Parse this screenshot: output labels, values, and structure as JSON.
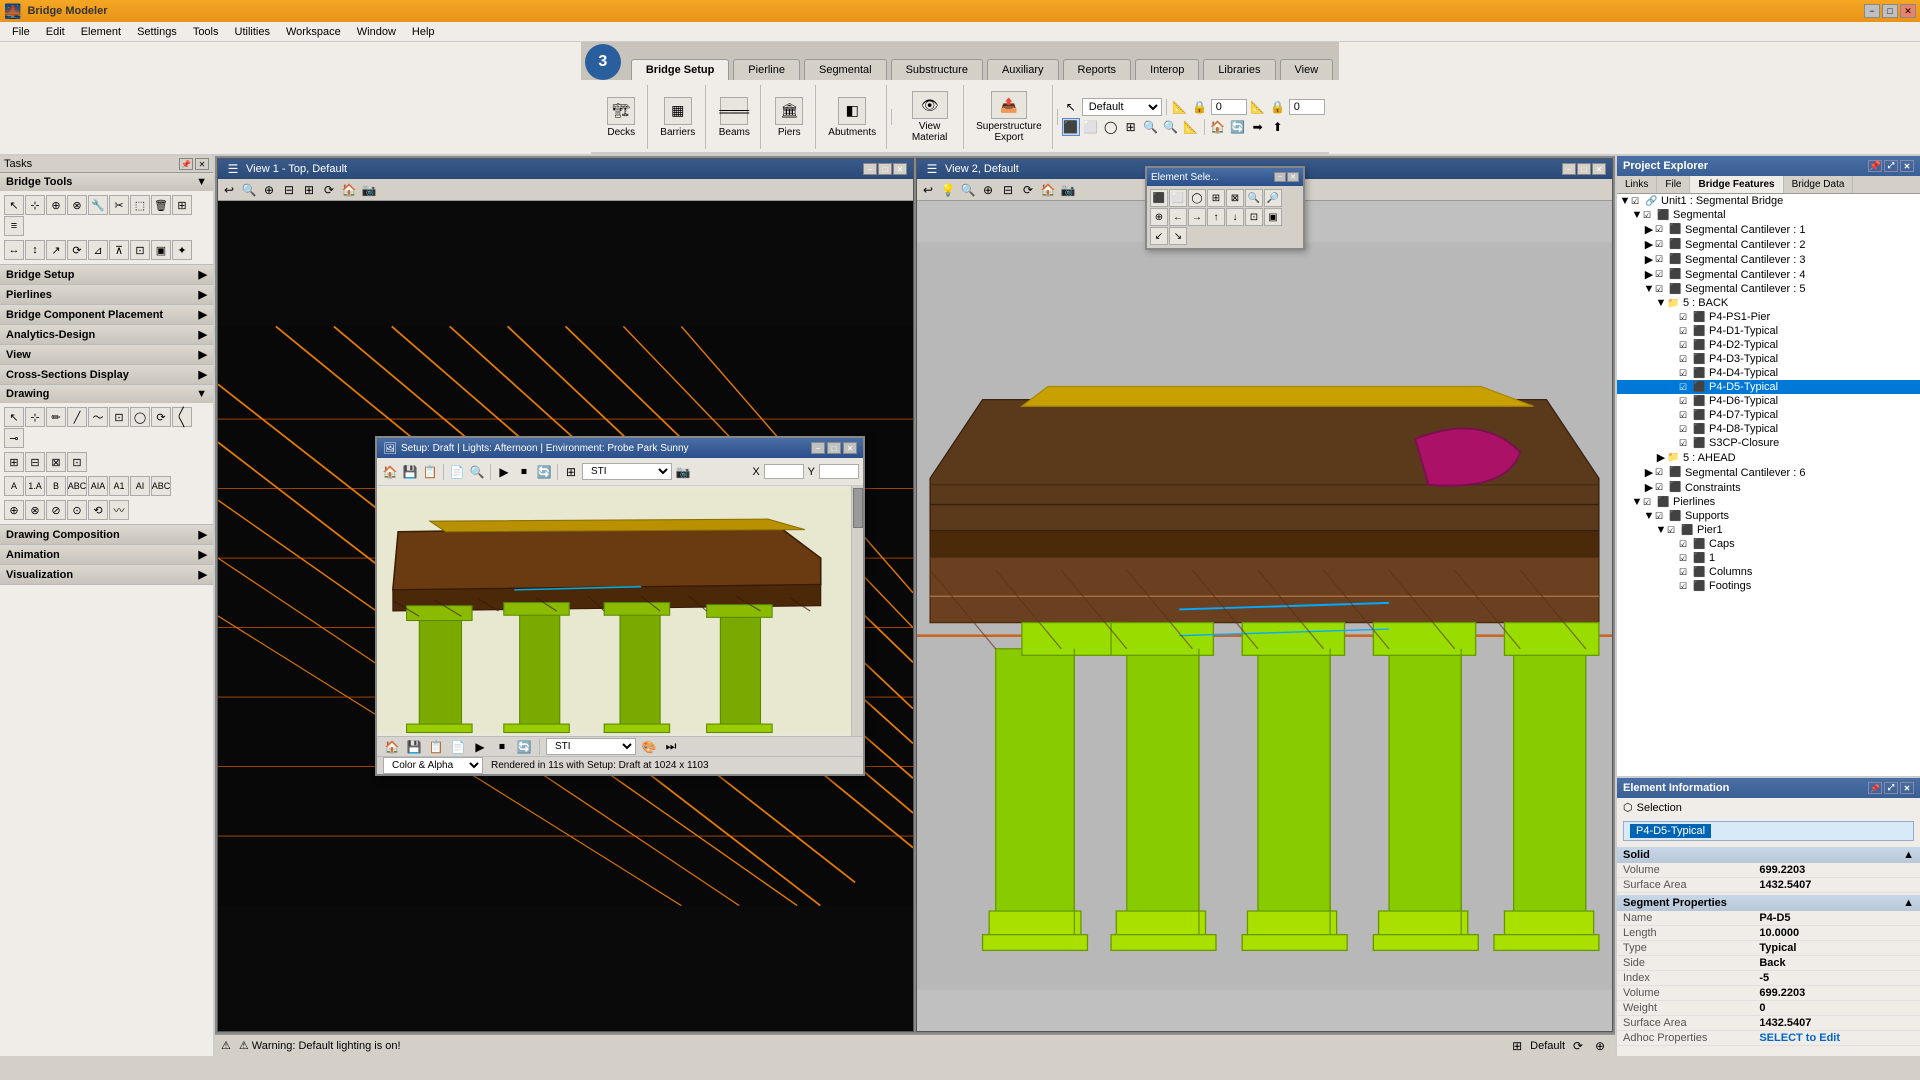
{
  "app": {
    "title": "Bridge Modeler",
    "logo": "3"
  },
  "titlebar": {
    "title": "Bridge Modeler",
    "min": "−",
    "max": "□",
    "close": "✕"
  },
  "menubar": {
    "items": [
      "File",
      "Edit",
      "Element",
      "Settings",
      "Tools",
      "Utilities",
      "Workspace",
      "Window",
      "Help"
    ]
  },
  "nav_tabs": {
    "items": [
      "Bridge Setup",
      "Pierline",
      "Segmental",
      "Substructure",
      "Auxiliary",
      "Reports",
      "Interop",
      "Libraries",
      "View"
    ],
    "active": "Bridge Setup"
  },
  "toolbar_sections": {
    "decks": {
      "label": "Decks",
      "icon": "🏗"
    },
    "barriers": {
      "label": "Barriers",
      "icon": "🔲"
    },
    "beams": {
      "label": "Beams",
      "icon": "═"
    },
    "piers": {
      "label": "Piers",
      "icon": "🏛"
    },
    "abutments": {
      "label": "Abutments",
      "icon": "◧"
    },
    "view_material": {
      "label": "View\nMaterial",
      "icon": "👁"
    },
    "superstructure_export": {
      "label": "Superstructure\nExport",
      "icon": "📤"
    }
  },
  "left_panel": {
    "header": "Tasks",
    "sections": [
      {
        "id": "bridge-tools",
        "label": "Bridge Tools",
        "expanded": true
      },
      {
        "id": "bridge-setup",
        "label": "Bridge Setup",
        "expanded": false
      },
      {
        "id": "pierlines",
        "label": "Pierlines",
        "expanded": false
      },
      {
        "id": "bridge-component-placement",
        "label": "Bridge Component Placement",
        "expanded": false
      },
      {
        "id": "analytics-design",
        "label": "Analytics-Design",
        "expanded": false
      },
      {
        "id": "view",
        "label": "View",
        "expanded": false
      },
      {
        "id": "cross-sections-display",
        "label": "Cross-Sections Display",
        "expanded": false
      },
      {
        "id": "drawing",
        "label": "Drawing",
        "expanded": true
      },
      {
        "id": "drawing-composition",
        "label": "Drawing Composition",
        "expanded": false
      },
      {
        "id": "animation",
        "label": "Animation",
        "expanded": false
      },
      {
        "id": "visualization",
        "label": "Visualization",
        "expanded": false
      }
    ]
  },
  "views": {
    "view1": {
      "title": "View 1 - Top, Default"
    },
    "view2": {
      "title": "View 2, Default"
    }
  },
  "float_window": {
    "title": "Setup: Draft | Lights: Afternoon | Environment: Probe Park Sunny",
    "x": "1024",
    "y": "1103",
    "rendered_text": "Rendered in 11s with Setup: Draft at 1024 x 1103",
    "color_mode": "Color & Alpha"
  },
  "element_selector": {
    "title": "Element Sele..."
  },
  "project_explorer": {
    "title": "Project Explorer",
    "tabs": [
      "Links",
      "File",
      "Bridge Features",
      "Bridge Data"
    ],
    "active_tab": "Bridge Features",
    "tree": [
      {
        "level": 1,
        "label": "Unit1 : Segmental Bridge",
        "expanded": true,
        "checked": true
      },
      {
        "level": 2,
        "label": "Segmental",
        "expanded": true,
        "checked": true
      },
      {
        "level": 3,
        "label": "Segmental Cantilever : 1",
        "checked": true
      },
      {
        "level": 3,
        "label": "Segmental Cantilever : 2",
        "checked": true
      },
      {
        "level": 3,
        "label": "Segmental Cantilever : 3",
        "checked": true
      },
      {
        "level": 3,
        "label": "Segmental Cantilever : 4",
        "checked": true
      },
      {
        "level": 3,
        "label": "Segmental Cantilever : 5",
        "checked": true,
        "expanded": true
      },
      {
        "level": 4,
        "label": "5 : BACK",
        "expanded": true
      },
      {
        "level": 5,
        "label": "P4-PS1-Pier",
        "checked": true
      },
      {
        "level": 5,
        "label": "P4-D1-Typical",
        "checked": true
      },
      {
        "level": 5,
        "label": "P4-D2-Typical",
        "checked": true
      },
      {
        "level": 5,
        "label": "P4-D3-Typical",
        "checked": true
      },
      {
        "level": 5,
        "label": "P4-D4-Typical",
        "checked": true
      },
      {
        "level": 5,
        "label": "P4-D5-Typical",
        "checked": true,
        "selected": true
      },
      {
        "level": 5,
        "label": "P4-D6-Typical",
        "checked": true
      },
      {
        "level": 5,
        "label": "P4-D7-Typical",
        "checked": true
      },
      {
        "level": 5,
        "label": "P4-D8-Typical",
        "checked": true
      },
      {
        "level": 5,
        "label": "S3CP-Closure",
        "checked": true
      },
      {
        "level": 4,
        "label": "5 : AHEAD",
        "expanded": false
      },
      {
        "level": 3,
        "label": "Segmental Cantilever : 6",
        "checked": true
      },
      {
        "level": 3,
        "label": "Constraints",
        "checked": true
      },
      {
        "level": 2,
        "label": "Pierlines",
        "expanded": true,
        "checked": true
      },
      {
        "level": 3,
        "label": "Supports",
        "checked": true,
        "expanded": true
      },
      {
        "level": 4,
        "label": "Pier1",
        "checked": true,
        "expanded": true
      },
      {
        "level": 5,
        "label": "Caps",
        "checked": true
      },
      {
        "level": 5,
        "label": "1",
        "checked": true
      },
      {
        "level": 5,
        "label": "Columns",
        "checked": true
      },
      {
        "level": 5,
        "label": "Footings",
        "checked": true
      }
    ]
  },
  "element_info": {
    "title": "Element Information",
    "selection_label": "Selection",
    "selected_item": "P4-D5-Typical",
    "solid": {
      "header": "Solid",
      "volume_label": "Volume",
      "volume_value": "699.2203",
      "surface_area_label": "Surface Area",
      "surface_area_value": "1432.5407"
    },
    "segment_properties": {
      "header": "Segment Properties",
      "name_label": "Name",
      "name_value": "P4-D5",
      "length_label": "Length",
      "length_value": "10.0000",
      "type_label": "Type",
      "type_value": "Typical",
      "side_label": "Side",
      "side_value": "Back",
      "index_label": "Index",
      "index_value": "-5",
      "volume_label": "Volume",
      "volume_value": "699.2203",
      "weight_label": "Weight",
      "weight_value": "0",
      "surface_area_label": "Surface Area",
      "surface_area_value": "1432.5407",
      "adhoc_label": "Adhoc Properties",
      "adhoc_value": "SELECT to Edit"
    }
  },
  "statusbar": {
    "warning": "⚠ Warning: Default lighting is on!",
    "mode": "Default"
  },
  "secondary_toolbar": {
    "zoom_label": "Default",
    "spin": "0"
  }
}
